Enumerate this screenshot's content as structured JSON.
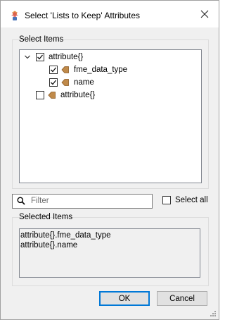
{
  "window": {
    "title": "Select 'Lists to Keep' Attributes"
  },
  "select_items": {
    "label": "Select Items",
    "tree": [
      {
        "label": "attribute{}",
        "checked": true,
        "expanded": true,
        "level": 0
      },
      {
        "label": "fme_data_type",
        "checked": true,
        "level": 1
      },
      {
        "label": "name",
        "checked": true,
        "level": 1
      },
      {
        "label": "attribute{}",
        "checked": false,
        "level": 0
      }
    ]
  },
  "filter": {
    "placeholder": "Filter",
    "value": ""
  },
  "select_all": {
    "label": "Select all",
    "checked": false
  },
  "selected_items": {
    "label": "Selected Items",
    "lines": [
      "attribute{}.fme_data_type",
      "attribute{}.name"
    ]
  },
  "buttons": {
    "ok": "OK",
    "cancel": "Cancel"
  },
  "colors": {
    "accent": "#0078d7",
    "attribute_icon": "#c08a4a"
  }
}
